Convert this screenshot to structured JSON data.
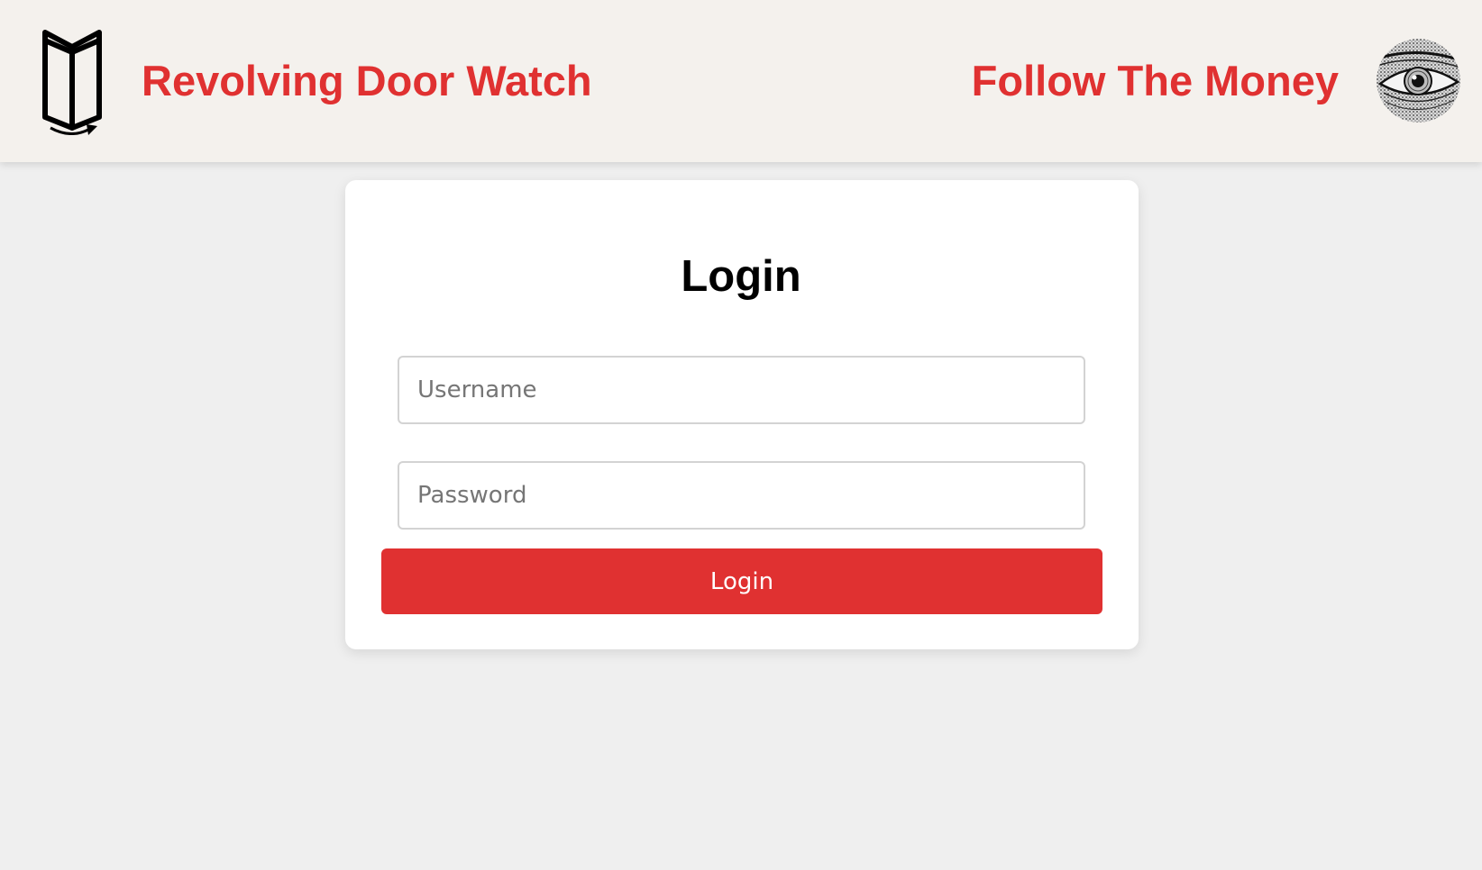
{
  "header": {
    "brand_title": "Revolving Door Watch",
    "logo_icon": "revolving-door-icon",
    "follow_link_label": "Follow The Money",
    "avatar_icon": "eye-icon"
  },
  "login_form": {
    "title": "Login",
    "username": {
      "value": "",
      "placeholder": "Username"
    },
    "password": {
      "value": "",
      "placeholder": "Password"
    },
    "submit_label": "Login"
  },
  "colors": {
    "accent": "#e03131",
    "header_background": "#f4f1ed",
    "page_background": "#efefef",
    "card_background": "#ffffff"
  }
}
